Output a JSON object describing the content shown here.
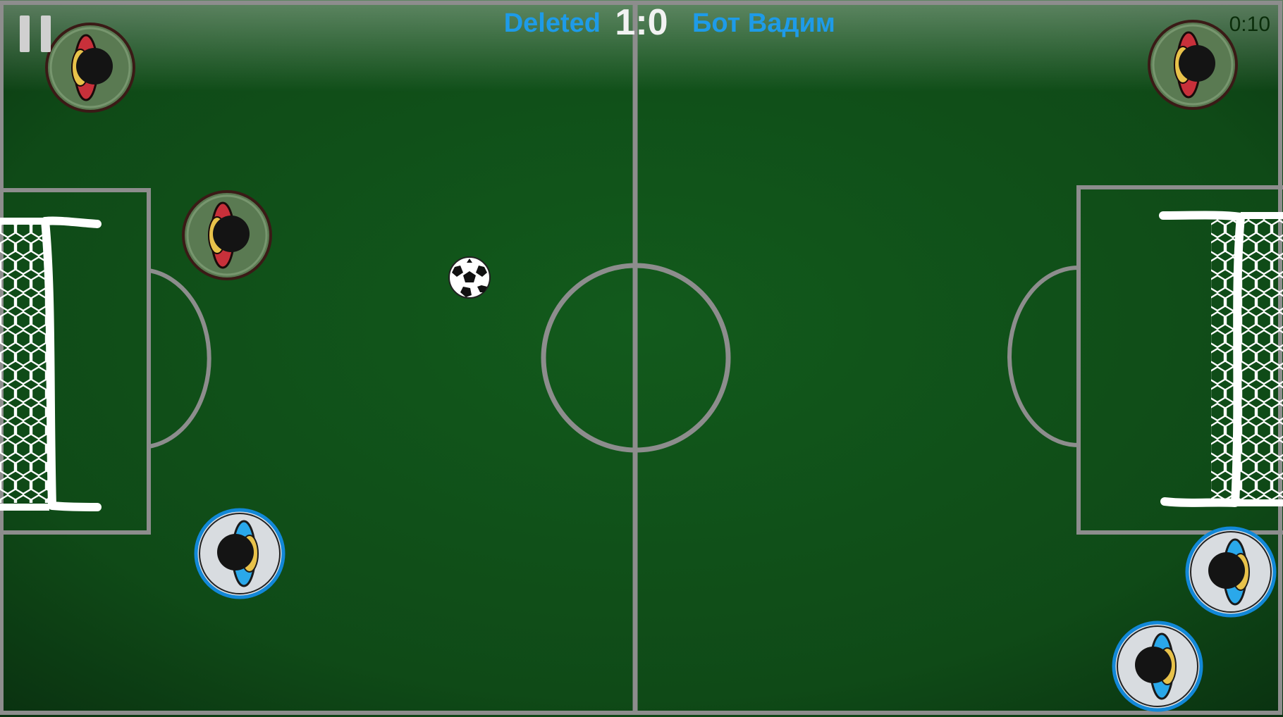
{
  "hud": {
    "team_left": "Deleted",
    "score": "1:0",
    "team_right": "Бот Вадим",
    "timer": "0:10",
    "pause_icon": "pause-icon"
  },
  "teams": {
    "red": {
      "jersey_color": "#c8303a",
      "disc_color": "#5a7a52",
      "ring_color": "#3a1a16"
    },
    "blue": {
      "jersey_color": "#2aa8ea",
      "disc_color": "#d8dce0",
      "ring_color": "#1288d8"
    }
  },
  "field": {
    "grass_color": "#0f4a17",
    "line_color": "#8d8d8d"
  }
}
